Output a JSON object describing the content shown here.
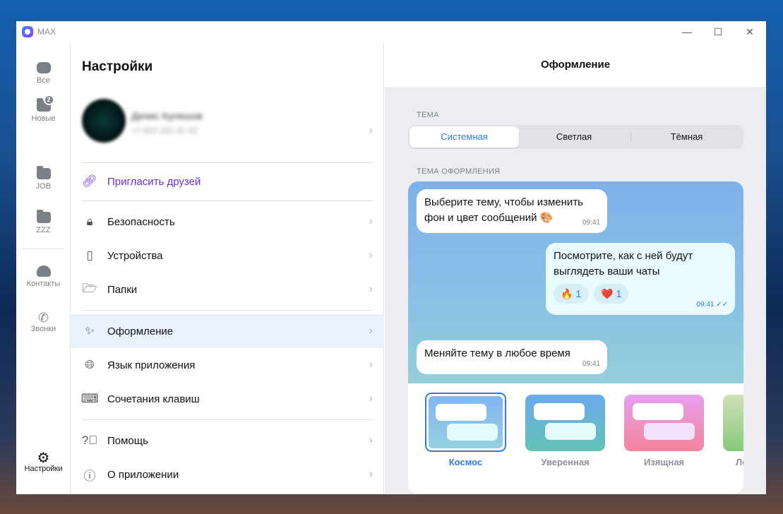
{
  "app": {
    "title": "MAX"
  },
  "window_controls": {
    "minimize": "—",
    "maximize": "☐",
    "close": "✕"
  },
  "rail": {
    "items": [
      {
        "label": "Все",
        "icon": "chat-icon"
      },
      {
        "label": "Новые",
        "icon": "folder-icon",
        "badge": "2"
      },
      {
        "label": "JOB",
        "icon": "folder-icon"
      },
      {
        "label": "ZZZ",
        "icon": "folder-icon"
      },
      {
        "label": "Контакты",
        "icon": "contacts-icon"
      },
      {
        "label": "Звонки",
        "icon": "phone-icon"
      },
      {
        "label": "Настройки",
        "icon": "gear-icon"
      }
    ]
  },
  "settings": {
    "title": "Настройки",
    "profile": {
      "name": "Денис Кулешов",
      "phone": "+7 922 222 41 42"
    },
    "invite": "Пригласить друзей",
    "items": [
      "Безопасность",
      "Устройства",
      "Папки",
      "Оформление",
      "Язык приложения",
      "Сочетания клавиш",
      "Помощь",
      "О приложении"
    ]
  },
  "appearance": {
    "title": "Оформление",
    "theme_label": "ТЕМА",
    "theme_options": [
      "Системная",
      "Светлая",
      "Тёмная"
    ],
    "selected_theme": "Системная",
    "design_label": "ТЕМА ОФОРМЛЕНИЯ",
    "messages": [
      {
        "text": "Выберите тему, чтобы изменить фон и цвет сообщений 🎨",
        "time": "09:41"
      },
      {
        "text": "Посмотрите, как с ней будут выглядеть ваши чаты",
        "time": "09:41",
        "reactions": [
          {
            "emoji": "🔥",
            "count": "1"
          },
          {
            "emoji": "❤️",
            "count": "1"
          }
        ]
      },
      {
        "text": "Меняйте тему в любое время",
        "time": "09:41"
      }
    ],
    "themes": [
      "Космос",
      "Уверенная",
      "Изящная",
      "Ле"
    ],
    "selected": "Космос",
    "accent": "#2d7dde"
  }
}
